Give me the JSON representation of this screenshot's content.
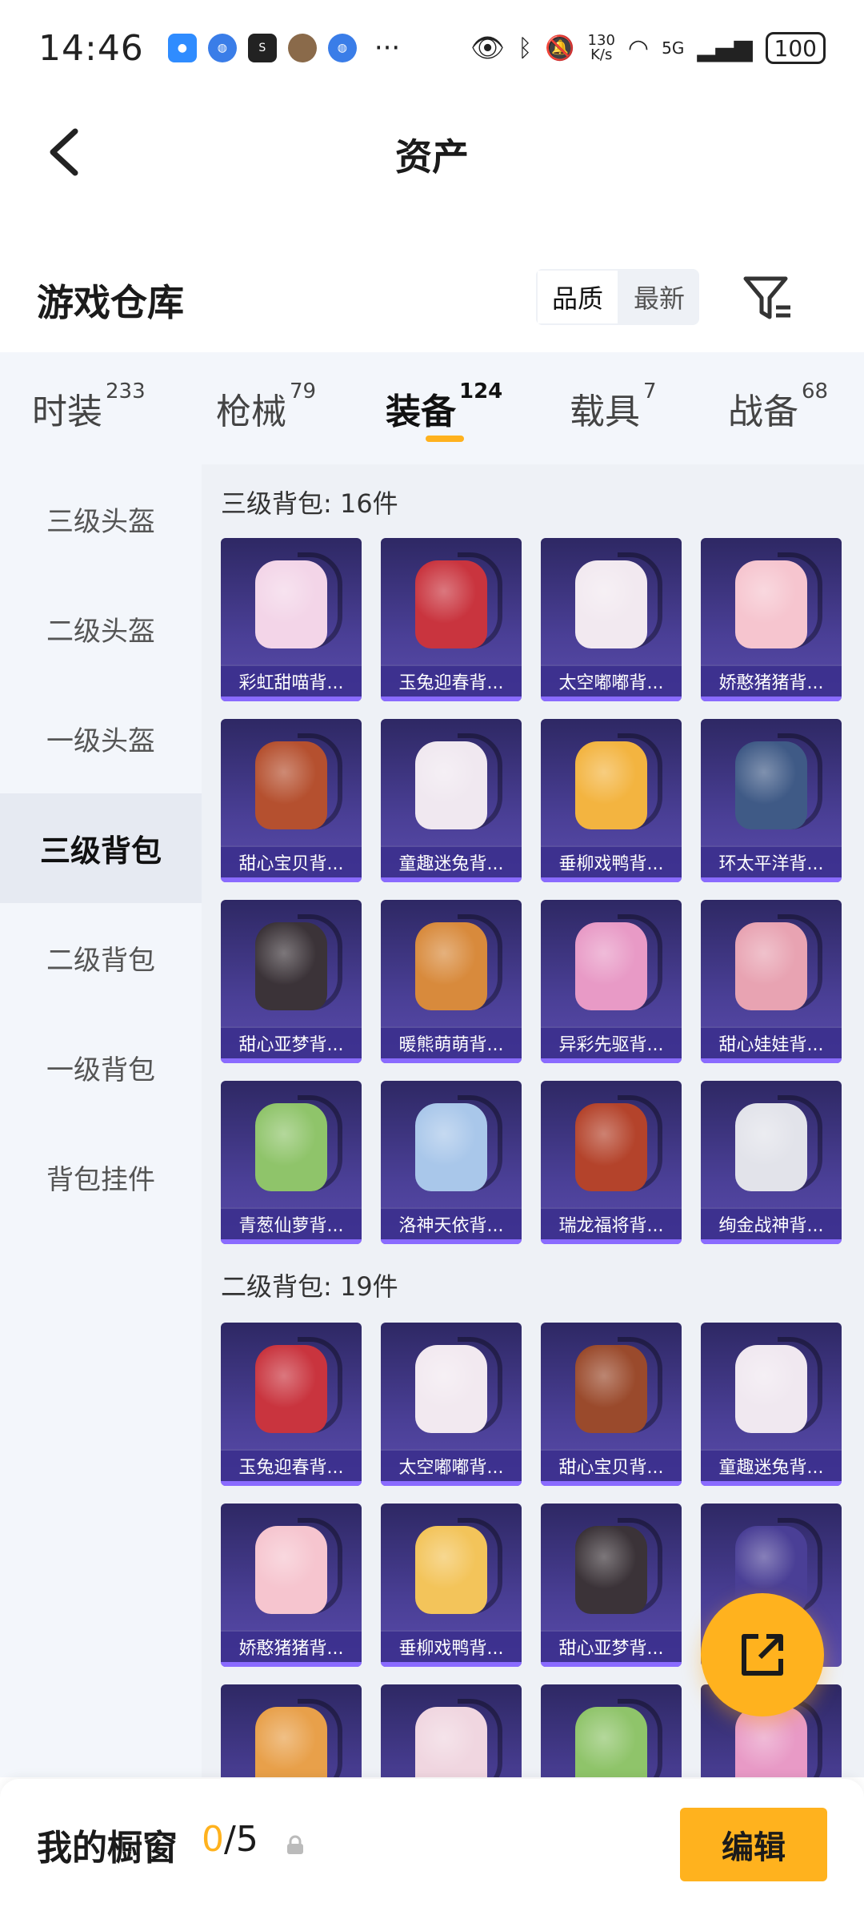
{
  "status_bar": {
    "time": "14:46",
    "net_speed_top": "130",
    "net_speed_bottom": "K/s",
    "network": "5G",
    "battery": "100",
    "more": "···"
  },
  "header": {
    "title": "资产"
  },
  "warehouse": {
    "title": "游戏仓库",
    "sort_options": [
      "品质",
      "最新"
    ],
    "selected_sort": "品质"
  },
  "tabs": [
    {
      "label": "时装",
      "count": "233"
    },
    {
      "label": "枪械",
      "count": "79"
    },
    {
      "label": "装备",
      "count": "124"
    },
    {
      "label": "载具",
      "count": "7"
    },
    {
      "label": "战备",
      "count": "68"
    }
  ],
  "active_tab": "装备",
  "sidebar": [
    "三级头盔",
    "二级头盔",
    "一级头盔",
    "三级背包",
    "二级背包",
    "一级背包",
    "背包挂件"
  ],
  "active_sidebar": "三级背包",
  "sections": [
    {
      "title": "三级背包: 16件",
      "items": [
        {
          "name": "彩虹甜喵背...",
          "color": "#f3d5e8"
        },
        {
          "name": "玉兔迎春背...",
          "color": "#c9343e"
        },
        {
          "name": "太空嘟嘟背...",
          "color": "#f2e9f0"
        },
        {
          "name": "娇憨猪猪背...",
          "color": "#f6c5cf"
        },
        {
          "name": "甜心宝贝背...",
          "color": "#b5502f"
        },
        {
          "name": "童趣迷兔背...",
          "color": "#f0e8f0"
        },
        {
          "name": "垂柳戏鸭背...",
          "color": "#f3b440"
        },
        {
          "name": "环太平洋背...",
          "color": "#3f5a86"
        },
        {
          "name": "甜心亚梦背...",
          "color": "#3b3338"
        },
        {
          "name": "暖熊萌萌背...",
          "color": "#d88a3c"
        },
        {
          "name": "异彩先驱背...",
          "color": "#e89ac6"
        },
        {
          "name": "甜心娃娃背...",
          "color": "#e8a3b2"
        },
        {
          "name": "青葱仙萝背...",
          "color": "#8fc46a"
        },
        {
          "name": "洛神天依背...",
          "color": "#a9c7ea"
        },
        {
          "name": "瑞龙福将背...",
          "color": "#b4432b"
        },
        {
          "name": "绚金战神背...",
          "color": "#e2e3ea"
        }
      ]
    },
    {
      "title": "二级背包: 19件",
      "items": [
        {
          "name": "玉兔迎春背...",
          "color": "#c9343e"
        },
        {
          "name": "太空嘟嘟背...",
          "color": "#f2e9f0"
        },
        {
          "name": "甜心宝贝背...",
          "color": "#9a4a2c"
        },
        {
          "name": "童趣迷兔背...",
          "color": "#f0e8f0"
        },
        {
          "name": "娇憨猪猪背...",
          "color": "#f6c5cf"
        },
        {
          "name": "垂柳戏鸭背...",
          "color": "#f3c45a"
        },
        {
          "name": "甜心亚梦背...",
          "color": "#3b3338"
        },
        {
          "name": "",
          "color": "#4a3f96"
        },
        {
          "name": "",
          "color": "#e8a04a"
        },
        {
          "name": "",
          "color": "#f0d6e0"
        },
        {
          "name": "",
          "color": "#8fc46a"
        },
        {
          "name": "",
          "color": "#e89ac6"
        }
      ]
    }
  ],
  "bottom_bar": {
    "title": "我的橱窗",
    "count_current": "0",
    "count_total": "/5",
    "edit_label": "编辑"
  },
  "colors": {
    "accent": "#ffb21e",
    "card_top": "#2e2864",
    "card_bottom": "#5a4cab"
  }
}
